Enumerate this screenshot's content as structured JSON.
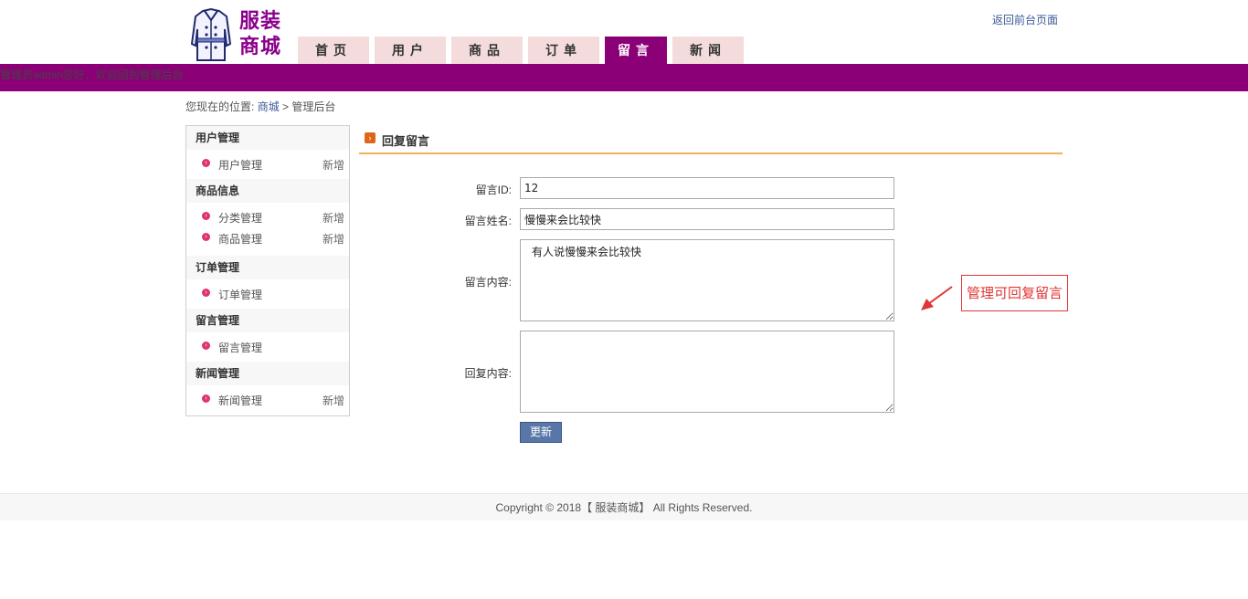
{
  "header": {
    "logo_lines": [
      "服装",
      "商城"
    ],
    "top_link": "返回前台页面",
    "nav": [
      {
        "label": "首页",
        "active": false
      },
      {
        "label": "用户",
        "active": false
      },
      {
        "label": "商品",
        "active": false
      },
      {
        "label": "订单",
        "active": false
      },
      {
        "label": "留言",
        "active": true
      },
      {
        "label": "新闻",
        "active": false
      }
    ],
    "welcome": "管理员admin您好，欢迎回到管理后台"
  },
  "breadcrumb": {
    "prefix": "您现在的位置:",
    "home": "商城",
    "separator": ">",
    "current": "管理后台"
  },
  "sidebar": {
    "groups": [
      {
        "title": "用户管理",
        "items": [
          {
            "label": "用户管理",
            "action": "新增"
          }
        ]
      },
      {
        "title": "商品信息",
        "items": [
          {
            "label": "分类管理",
            "action": "新增"
          },
          {
            "label": "商品管理",
            "action": "新增"
          }
        ]
      },
      {
        "title": "订单管理",
        "items": [
          {
            "label": "订单管理",
            "action": ""
          }
        ]
      },
      {
        "title": "留言管理",
        "items": [
          {
            "label": "留言管理",
            "action": ""
          }
        ]
      },
      {
        "title": "新闻管理",
        "items": [
          {
            "label": "新闻管理",
            "action": "新增"
          }
        ]
      }
    ]
  },
  "panel": {
    "title": "回复留言"
  },
  "form": {
    "id_label": "留言ID:",
    "id_value": "12",
    "name_label": "留言姓名:",
    "name_value": "慢慢来会比较快",
    "content_label": "留言内容:",
    "content_value": "有人说慢慢来会比较快",
    "reply_label": "回复内容:",
    "reply_value": "",
    "submit_label": "更新"
  },
  "annotation": {
    "note": "管理可回复留言",
    "color": "#e03535"
  },
  "footer": {
    "text": "Copyright © 2018【 服装商城】 All Rights Reserved."
  },
  "colors": {
    "brand": "#8b0076",
    "tab_bg": "#f4dcdc",
    "button": "#5876a7"
  }
}
